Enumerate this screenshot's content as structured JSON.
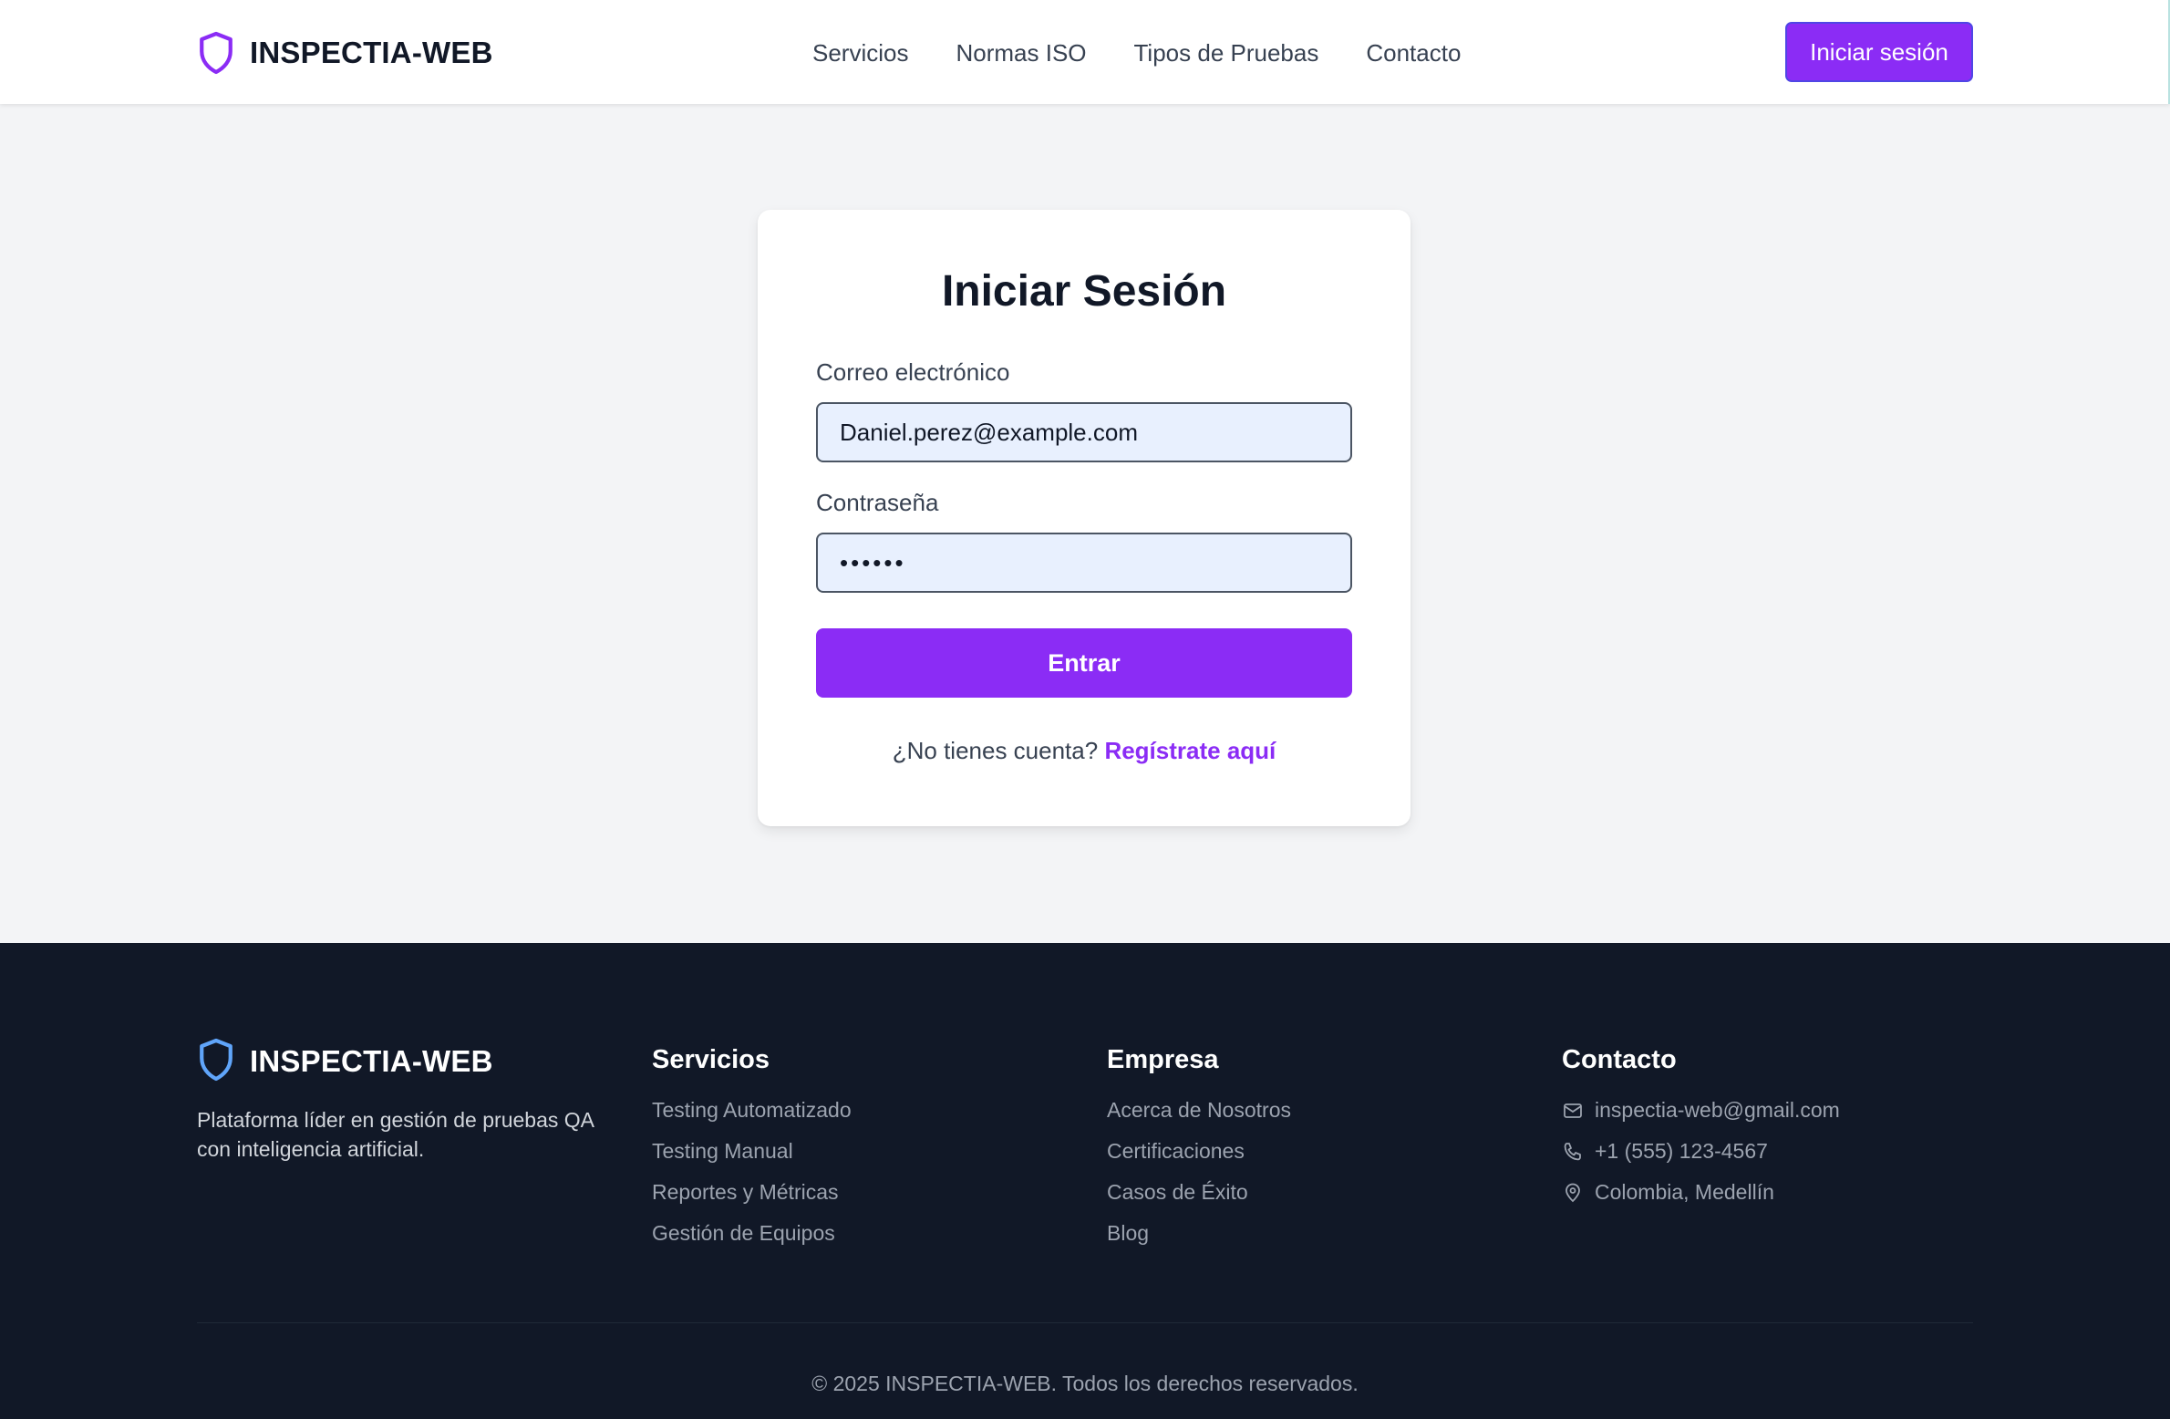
{
  "brand": {
    "name": "INSPECTIA-WEB",
    "accent_color": "#8b2cf5",
    "footer_shield_color": "#60a5fa",
    "icon": "shield-icon"
  },
  "nav": {
    "items": [
      {
        "label": "Servicios"
      },
      {
        "label": "Normas ISO"
      },
      {
        "label": "Tipos de Pruebas"
      },
      {
        "label": "Contacto"
      }
    ],
    "login_label": "Iniciar sesión"
  },
  "login": {
    "title": "Iniciar Sesión",
    "email_label": "Correo electrónico",
    "email_value": "Daniel.perez@example.com",
    "password_label": "Contraseña",
    "password_value": "••••••",
    "submit_label": "Entrar",
    "register_prompt": "¿No tienes cuenta?",
    "register_link": "Regístrate aquí"
  },
  "footer": {
    "description": "Plataforma líder en gestión de pruebas QA con inteligencia artificial.",
    "services": {
      "title": "Servicios",
      "items": [
        "Testing Automatizado",
        "Testing Manual",
        "Reportes y Métricas",
        "Gestión de Equipos"
      ]
    },
    "company": {
      "title": "Empresa",
      "items": [
        "Acerca de Nosotros",
        "Certificaciones",
        "Casos de Éxito",
        "Blog"
      ]
    },
    "contact": {
      "title": "Contacto",
      "email": "inspectia-web@gmail.com",
      "phone": "+1 (555) 123-4567",
      "location": "Colombia, Medellín"
    },
    "copyright": "© 2025 INSPECTIA-WEB. Todos los derechos reservados."
  }
}
